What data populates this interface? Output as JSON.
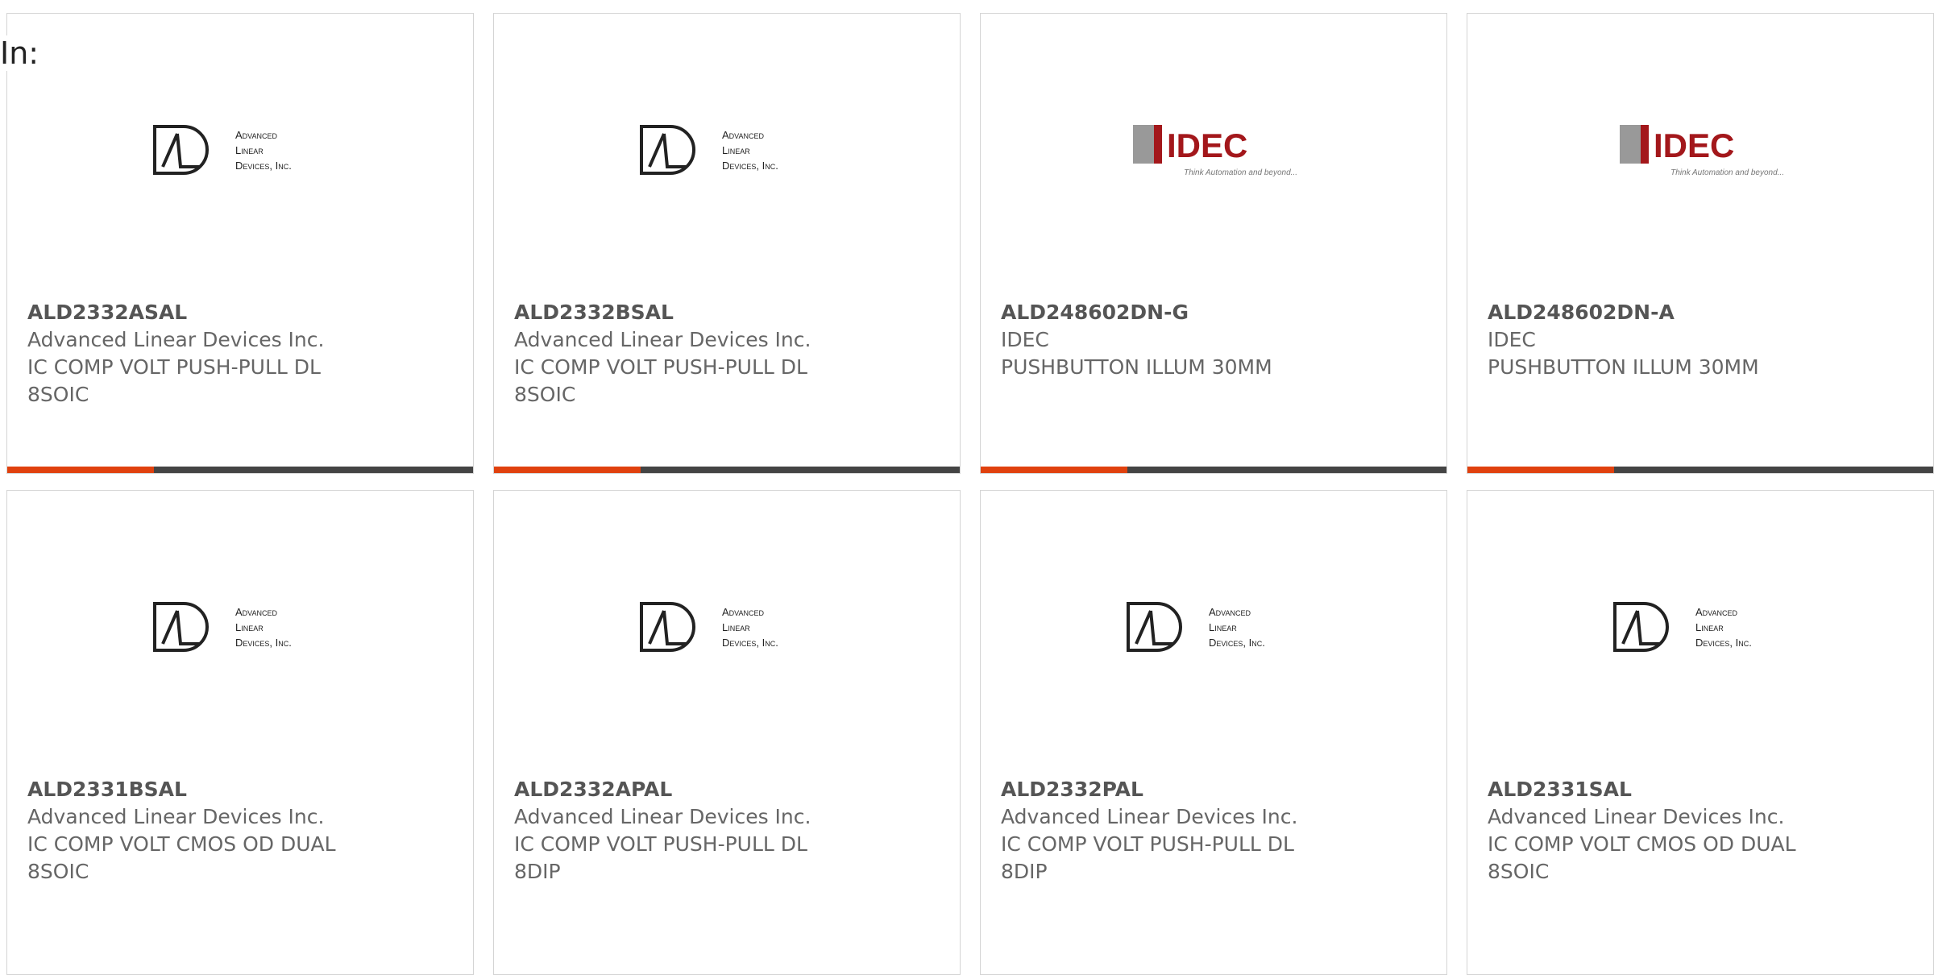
{
  "filter_label": "In:",
  "products": [
    {
      "part": "ALD2332ASAL",
      "manufacturer": "Advanced Linear Devices Inc.",
      "description": "IC COMP VOLT PUSH-PULL DL 8SOIC",
      "logo": "ald-logo",
      "accent_bar": true
    },
    {
      "part": "ALD2332BSAL",
      "manufacturer": "Advanced Linear Devices Inc.",
      "description": "IC COMP VOLT PUSH-PULL DL 8SOIC",
      "logo": "ald-logo",
      "accent_bar": true
    },
    {
      "part": "ALD248602DN-G",
      "manufacturer": "IDEC",
      "description": "PUSHBUTTON ILLUM 30MM",
      "logo": "idec-logo",
      "accent_bar": true
    },
    {
      "part": "ALD248602DN-A",
      "manufacturer": "IDEC",
      "description": "PUSHBUTTON ILLUM 30MM",
      "logo": "idec-logo",
      "accent_bar": true
    },
    {
      "part": "ALD2331BSAL",
      "manufacturer": "Advanced Linear Devices Inc.",
      "description": "IC COMP VOLT CMOS OD DUAL 8SOIC",
      "logo": "ald-logo",
      "accent_bar": false
    },
    {
      "part": "ALD2332APAL",
      "manufacturer": "Advanced Linear Devices Inc.",
      "description": "IC COMP VOLT PUSH-PULL DL 8DIP",
      "logo": "ald-logo",
      "accent_bar": false
    },
    {
      "part": "ALD2332PAL",
      "manufacturer": "Advanced Linear Devices Inc.",
      "description": "IC COMP VOLT PUSH-PULL DL 8DIP",
      "logo": "ald-logo",
      "accent_bar": false
    },
    {
      "part": "ALD2331SAL",
      "manufacturer": "Advanced Linear Devices Inc.",
      "description": "IC COMP VOLT CMOS OD DUAL 8SOIC",
      "logo": "ald-logo",
      "accent_bar": false
    }
  ],
  "logos": {
    "ald": {
      "line1": "Advanced",
      "line2": "Linear",
      "line3": "Devices, Inc."
    },
    "idec": {
      "name": "IDEC",
      "tagline": "Think Automation and beyond..."
    }
  },
  "colors": {
    "accent": "#e0410e",
    "bar_dark": "#444444",
    "idec_red": "#a3171b"
  }
}
